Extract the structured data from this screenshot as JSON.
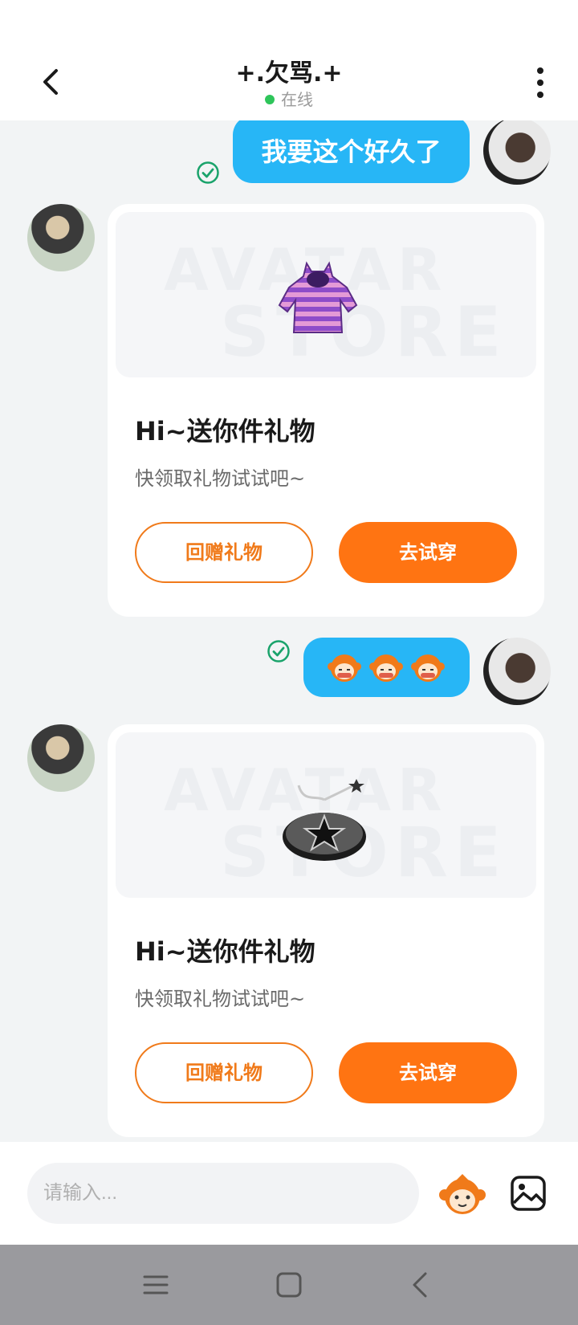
{
  "header": {
    "title": "+.欠骂.+",
    "status": "在线",
    "status_color": "#2ec55a"
  },
  "messages": [
    {
      "type": "text",
      "sender": "me",
      "text": "我要这个好久了",
      "read": true
    },
    {
      "type": "gift_card",
      "sender": "other",
      "image_icon": "purple-striped-hoodie-icon",
      "watermark": [
        "AVATAR",
        "STORE"
      ],
      "title": "Hi~送你件礼物",
      "subtitle": "快领取礼物试试吧~",
      "return_gift_label": "回赠礼物",
      "try_on_label": "去试穿"
    },
    {
      "type": "emoji",
      "sender": "me",
      "emoji_icons": [
        "monkey-sticker-icon",
        "monkey-sticker-icon",
        "monkey-sticker-icon"
      ],
      "read": true
    },
    {
      "type": "gift_card",
      "sender": "other",
      "image_icon": "star-disc-accessory-icon",
      "watermark": [
        "AVATAR",
        "STORE"
      ],
      "title": "Hi~送你件礼物",
      "subtitle": "快领取礼物试试吧~",
      "return_gift_label": "回赠礼物",
      "try_on_label": "去试穿"
    }
  ],
  "composer": {
    "placeholder": "请输入..."
  },
  "colors": {
    "bubble": "#27b6f6",
    "accent": "#ff7412",
    "read_check": "#1aa36b"
  }
}
